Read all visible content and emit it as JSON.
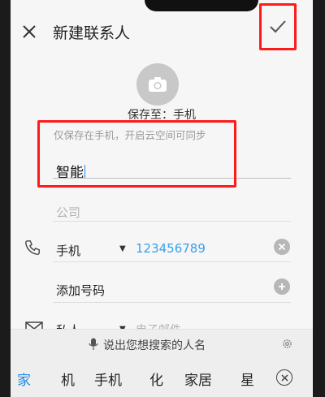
{
  "header": {
    "title": "新建联系人",
    "close_icon": "close-icon",
    "confirm_icon": "check-icon"
  },
  "photo": {
    "icon": "camera-icon"
  },
  "save_location": "保存至：手机",
  "sync_hint": "仅保存在手机，开启云空间可同步",
  "name_value": "智能",
  "company_placeholder": "公司",
  "phone": {
    "type": "手机",
    "number": "123456789"
  },
  "add_number_label": "添加号码",
  "email": {
    "type": "私人",
    "placeholder": "电子邮件"
  },
  "keyboard": {
    "voice_hint": "说出您想搜索的人名",
    "candidates": [
      "家",
      "机",
      "手机",
      "化",
      "家居",
      "星"
    ]
  },
  "colors": {
    "accent": "#1e88e5",
    "number": "#3aa0e8",
    "highlight": "#ff1a1a"
  }
}
